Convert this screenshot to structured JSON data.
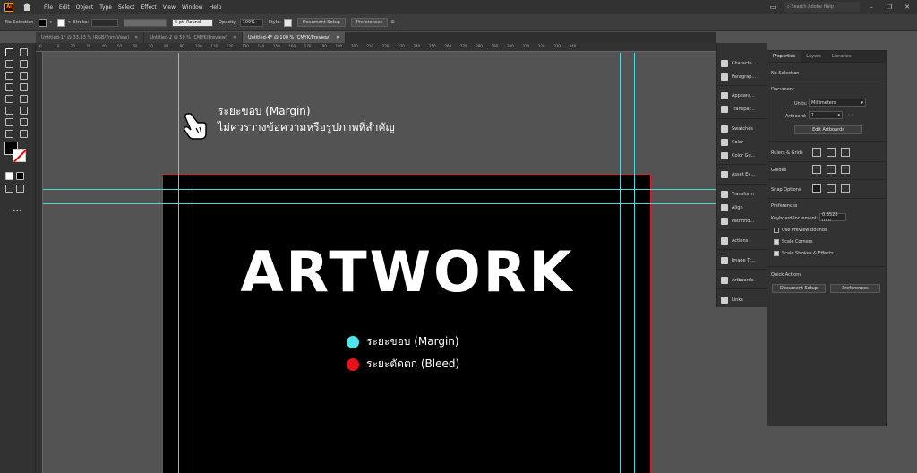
{
  "app": {
    "logo": "Ai",
    "menu": [
      "File",
      "Edit",
      "Object",
      "Type",
      "Select",
      "Effect",
      "View",
      "Window",
      "Help"
    ],
    "search_placeholder": "Search Adobe Help"
  },
  "control_bar": {
    "selection_label": "No Selection",
    "stroke_label": "Stroke:",
    "brush_value": "5 pt. Round",
    "opacity_label": "Opacity:",
    "opacity_value": "100%",
    "style_label": "Style:",
    "document_setup": "Document Setup",
    "preferences": "Preferences"
  },
  "tabs": [
    {
      "label": "Untitled-1* @ 33.33 % (RGB/Trim View)",
      "active": false
    },
    {
      "label": "Untitled-2 @ 50 % (CMYK/Preview)",
      "active": false
    },
    {
      "label": "Untitled-4* @ 100 % (CMYK/Preview)",
      "active": true
    }
  ],
  "ruler_labels": [
    "0",
    "10",
    "20",
    "30",
    "40",
    "50",
    "60",
    "70",
    "80",
    "90",
    "100",
    "110",
    "120",
    "130",
    "140",
    "150",
    "160",
    "170",
    "180",
    "190",
    "200",
    "210",
    "220",
    "230",
    "240",
    "250",
    "260",
    "270",
    "280",
    "290",
    "300",
    "310",
    "320",
    "330",
    "340"
  ],
  "canvas": {
    "annotation_line1": "ระยะขอบ (Margin)",
    "annotation_line2": "ไม่ควรวางข้อความหรือรูปภาพที่สำคัญ",
    "artwork_title": "ARTWORK",
    "legend": [
      {
        "label": "ระยะขอบ (Margin)",
        "color": "#4fe3ea"
      },
      {
        "label": "ระยะตัดตก (Bleed)",
        "color": "#e8121a"
      }
    ],
    "guide_color": "#4fd6dc",
    "bleed_color": "#d9222a"
  },
  "dock": [
    {
      "label": "Characte...",
      "icon": "character-icon"
    },
    {
      "label": "Paragrap...",
      "icon": "paragraph-icon"
    },
    {
      "label": "Appeara...",
      "icon": "appearance-icon"
    },
    {
      "label": "Transpar...",
      "icon": "transparency-icon"
    },
    {
      "label": "Swatches",
      "icon": "swatches-icon"
    },
    {
      "label": "Color",
      "icon": "color-icon"
    },
    {
      "label": "Color Gu...",
      "icon": "color-guide-icon"
    },
    {
      "label": "Asset Ex...",
      "icon": "asset-export-icon"
    },
    {
      "label": "Transform",
      "icon": "transform-icon"
    },
    {
      "label": "Align",
      "icon": "align-icon"
    },
    {
      "label": "Pathfind...",
      "icon": "pathfinder-icon"
    },
    {
      "label": "Actions",
      "icon": "actions-icon"
    },
    {
      "label": "Image Tr...",
      "icon": "image-trace-icon"
    },
    {
      "label": "Artboards",
      "icon": "artboards-icon"
    },
    {
      "label": "Links",
      "icon": "links-icon"
    }
  ],
  "properties": {
    "tabs": [
      "Properties",
      "Layers",
      "Libraries"
    ],
    "no_selection": "No Selection",
    "document_heading": "Document",
    "units_label": "Units:",
    "units_value": "Millimeters",
    "artboard_label": "Artboard:",
    "artboard_value": "1",
    "edit_artboards": "Edit Artboards",
    "rulers_grids": "Rulers & Grids",
    "guides": "Guides",
    "snap_options": "Snap Options",
    "preferences_heading": "Preferences",
    "keyboard_increment_label": "Keyboard Increment:",
    "keyboard_increment_value": "0.3528 mm",
    "use_preview_bounds": "Use Preview Bounds",
    "scale_corners": "Scale Corners",
    "scale_strokes": "Scale Strokes & Effects",
    "quick_actions": "Quick Actions",
    "document_setup": "Document Setup",
    "preferences_btn": "Preferences"
  }
}
